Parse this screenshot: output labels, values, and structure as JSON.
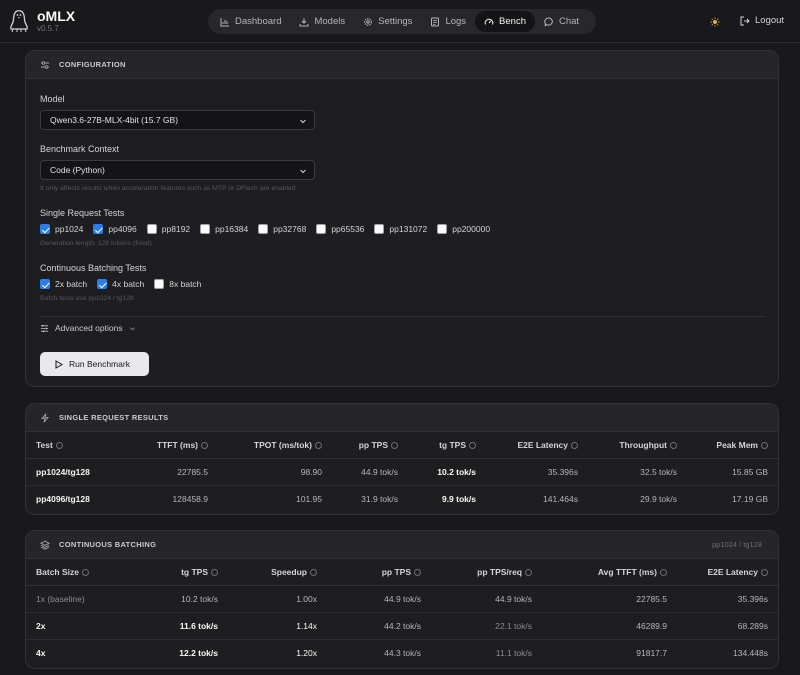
{
  "app": {
    "title": "oMLX",
    "version": "v0.5.7"
  },
  "nav": {
    "tabs": [
      {
        "label": "Dashboard",
        "icon": "chart-icon"
      },
      {
        "label": "Models",
        "icon": "download-icon"
      },
      {
        "label": "Settings",
        "icon": "gear-icon"
      },
      {
        "label": "Logs",
        "icon": "logs-icon"
      },
      {
        "label": "Bench",
        "icon": "gauge-icon"
      },
      {
        "label": "Chat",
        "icon": "chat-icon"
      }
    ],
    "active": "Bench",
    "logout_label": "Logout"
  },
  "config": {
    "header": "CONFIGURATION",
    "model_label": "Model",
    "model_value": "Qwen3.6-27B-MLX-4bit (15.7 GB)",
    "context_label": "Benchmark Context",
    "context_value": "Code (Python)",
    "context_hint": "It only affects results when acceleration features such as MTP or DFlash are enabled.",
    "single_label": "Single Request Tests",
    "single_tests": [
      {
        "label": "pp1024",
        "checked": true
      },
      {
        "label": "pp4096",
        "checked": true
      },
      {
        "label": "pp8192",
        "checked": false
      },
      {
        "label": "pp16384",
        "checked": false
      },
      {
        "label": "pp32768",
        "checked": false
      },
      {
        "label": "pp65536",
        "checked": false
      },
      {
        "label": "pp131072",
        "checked": false
      },
      {
        "label": "pp200000",
        "checked": false
      }
    ],
    "single_hint": "Generation length: 128 tokens (fixed)",
    "batch_label": "Continuous Batching Tests",
    "batch_tests": [
      {
        "label": "2x batch",
        "checked": true
      },
      {
        "label": "4x batch",
        "checked": true
      },
      {
        "label": "8x batch",
        "checked": false
      }
    ],
    "batch_hint": "Batch tests use pp1024 / tg128",
    "advanced_label": "Advanced options",
    "run_label": "Run Benchmark"
  },
  "single_results": {
    "header": "SINGLE REQUEST RESULTS",
    "columns": [
      "Test",
      "TTFT (ms)",
      "TPOT (ms/tok)",
      "pp TPS",
      "tg TPS",
      "E2E Latency",
      "Throughput",
      "Peak Mem"
    ],
    "rows": [
      [
        "pp1024/tg128",
        "22785.5",
        "98.90",
        "44.9 tok/s",
        "10.2 tok/s",
        "35.396s",
        "32.5 tok/s",
        "15.85 GB"
      ],
      [
        "pp4096/tg128",
        "128458.9",
        "101.95",
        "31.9 tok/s",
        "9.9 tok/s",
        "141.464s",
        "29.9 tok/s",
        "17.19 GB"
      ]
    ]
  },
  "batching": {
    "header": "CONTINUOUS BATCHING",
    "subtitle": "pp1024 / tg128",
    "columns": [
      "Batch Size",
      "tg TPS",
      "Speedup",
      "pp TPS",
      "pp TPS/req",
      "Avg TTFT (ms)",
      "E2E Latency"
    ],
    "rows": [
      [
        "1x (baseline)",
        "10.2 tok/s",
        "1.00x",
        "44.9 tok/s",
        "44.9 tok/s",
        "22785.5",
        "35.396s"
      ],
      [
        "2x",
        "11.6 tok/s",
        "1.14x",
        "44.2 tok/s",
        "22.1 tok/s",
        "46289.9",
        "68.289s"
      ],
      [
        "4x",
        "12.2 tok/s",
        "1.20x",
        "44.3 tok/s",
        "11.1 tok/s",
        "91817.7",
        "134.448s"
      ]
    ]
  }
}
